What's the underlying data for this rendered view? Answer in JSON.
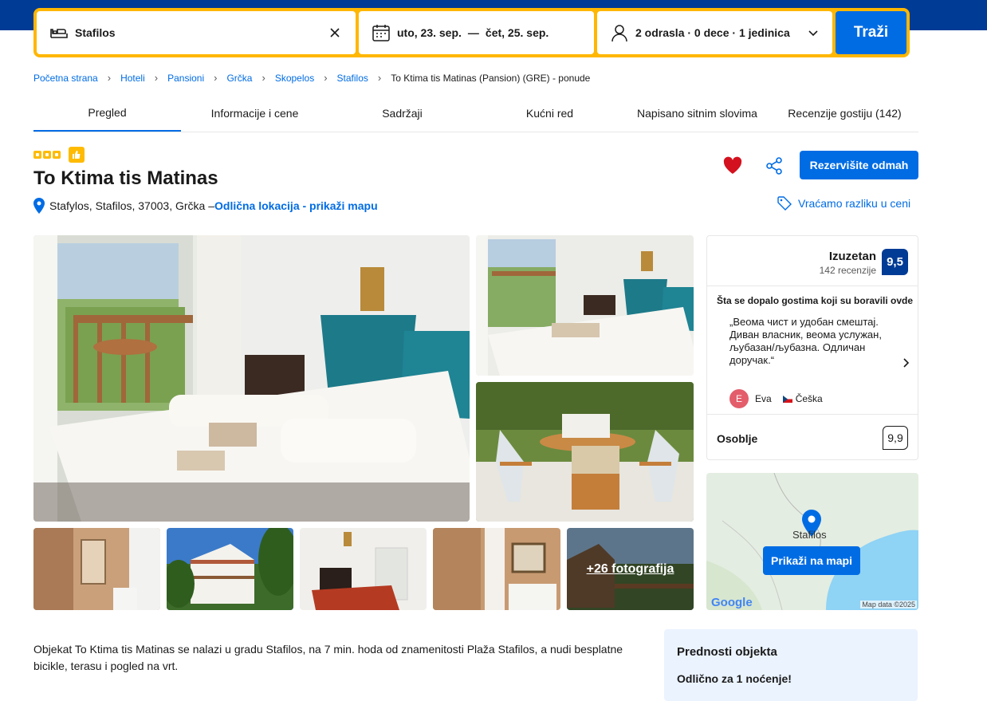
{
  "search": {
    "destination": "Stafilos",
    "date_start": "uto, 23. sep.",
    "date_sep": "—",
    "date_end": "čet, 25. sep.",
    "guests": "2 odrasla · 0 dece · 1 jedinica",
    "button": "Traži"
  },
  "breadcrumb": [
    "Početna strana",
    "Hoteli",
    "Pansioni",
    "Grčka",
    "Skopelos",
    "Stafilos"
  ],
  "breadcrumb_current": "To Ktima tis Matinas (Pansion) (GRE) - ponude",
  "tabs": [
    "Pregled",
    "Informacije i cene",
    "Sadržaji",
    "Kućni red",
    "Napisano sitnim slovima",
    "Recenzije gostiju (142)"
  ],
  "property": {
    "star_count": 3,
    "name": "To Ktima tis Matinas",
    "address": "Stafylos, Stafilos, 37003, Grčka – ",
    "location_link": "Odlična lokacija - prikaži mapu",
    "reserve_button": "Rezervišite odmah",
    "price_match": "Vraćamo razliku u ceni"
  },
  "gallery": {
    "more_photos": "+26 fotografija"
  },
  "review": {
    "word": "Izuzetan",
    "count": "142 recenzije",
    "score": "9,5",
    "liked_title": "Šta se dopalo gostima koji su boravili ovde",
    "quote": "„Веома чист и удобан смештај. Диван власник, веома услужан, љубазан/љубазна. Одличан доручак.“",
    "reviewer_initial": "E",
    "reviewer_name": "Eva",
    "reviewer_country": "Češka",
    "staff_label": "Osoblje",
    "staff_score": "9,9"
  },
  "map": {
    "button": "Prikaži na mapi",
    "place": "Stafilos",
    "google": "Google",
    "map_data": "Map data ©2025"
  },
  "description": "Objekat To Ktima tis Matinas se nalazi u gradu Stafilos, na 7 min. hoda od znamenitosti Plaža Stafilos, a nudi besplatne bicikle, terasu i pogled na vrt.",
  "highlights": {
    "title": "Prednosti objekta",
    "subtitle": "Odlično za 1 noćenje!"
  },
  "colors": {
    "brand_blue": "#003b95",
    "action_blue": "#006ce4",
    "search_border": "#ffb700",
    "star_yellow": "#febb02",
    "heart_red": "#d4111e"
  }
}
